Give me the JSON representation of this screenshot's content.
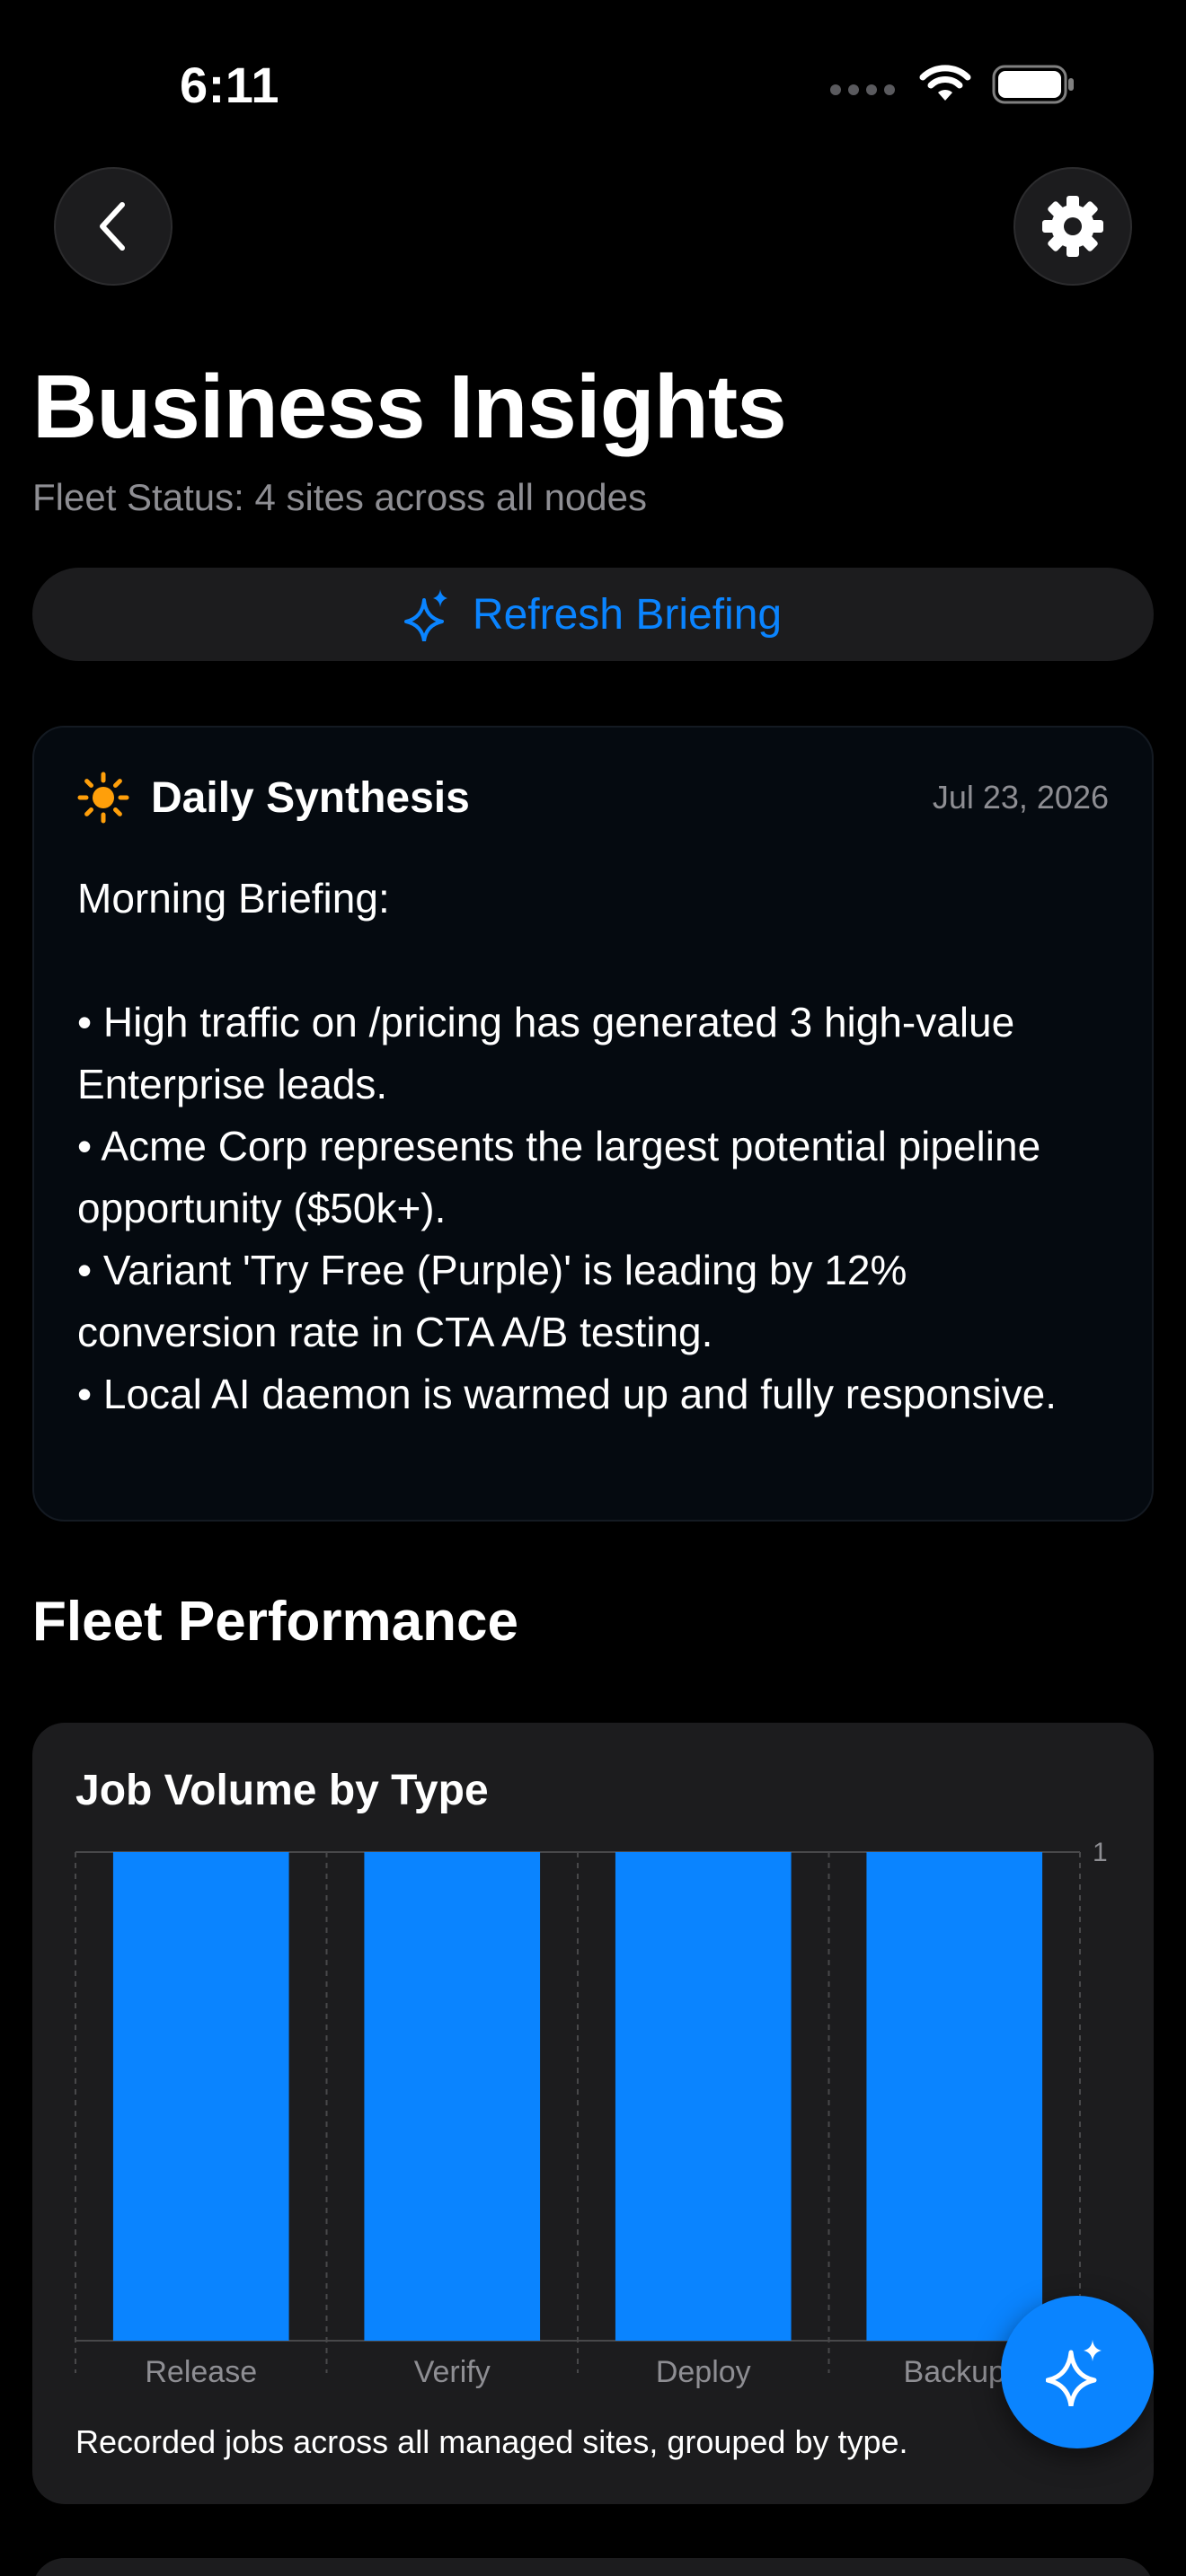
{
  "status_bar": {
    "time": "6:11"
  },
  "nav": {
    "back_icon": "chevron-left-icon",
    "settings_icon": "gear-icon"
  },
  "header": {
    "title": "Business Insights",
    "subtitle": "Fleet Status: 4 sites across all nodes"
  },
  "refresh": {
    "label": "Refresh Briefing",
    "icon": "sparkle-icon"
  },
  "synthesis": {
    "icon": "sun-icon",
    "title": "Daily Synthesis",
    "date": "Jul 23, 2026",
    "body": "Morning Briefing:\n\n• High traffic on /pricing has generated 3 high-value Enterprise leads.\n• Acme Corp represents the largest potential pipeline opportunity ($50k+).\n• Variant 'Try Free (Purple)' is leading by 12% conversion rate in CTA A/B testing.\n• Local AI daemon is warmed up and fully responsive."
  },
  "fleet": {
    "section_title": "Fleet Performance"
  },
  "chart_data": {
    "type": "bar",
    "title": "Job Volume by Type",
    "categories": [
      "Release",
      "Verify",
      "Deploy",
      "Backup"
    ],
    "values": [
      1,
      1,
      1,
      1
    ],
    "ylim": [
      0,
      1
    ],
    "y_ticks": [
      "1"
    ],
    "grid": true,
    "bar_color": "#0a84ff",
    "caption": "Recorded jobs across all managed sites, grouped by type."
  },
  "fab": {
    "icon": "sparkle-icon"
  },
  "colors": {
    "accent": "#0a84ff",
    "sun": "#ff9f0a",
    "card": "#1c1c1e"
  }
}
